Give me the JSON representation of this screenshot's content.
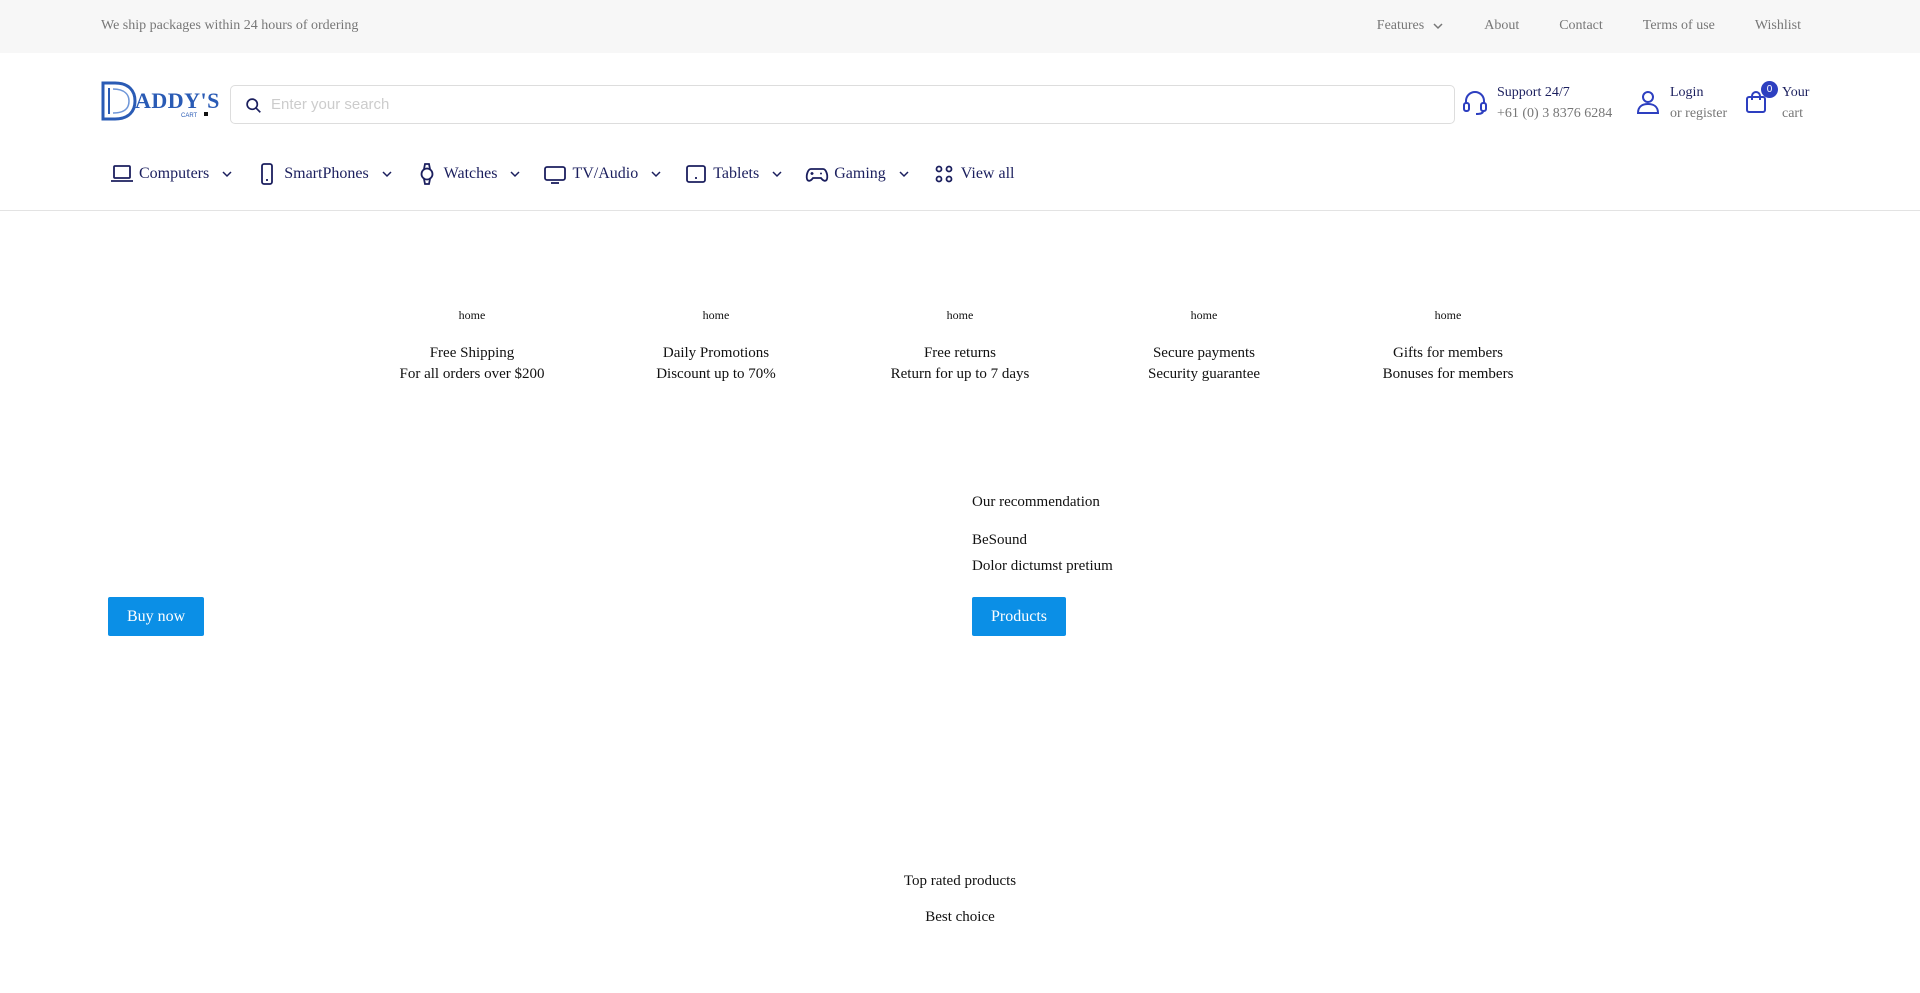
{
  "topbar": {
    "shipping_text": "We ship packages within 24 hours of ordering",
    "links": [
      "Features",
      "About",
      "Contact",
      "Terms of use",
      "Wishlist"
    ]
  },
  "search": {
    "placeholder": "Enter your search",
    "value": ""
  },
  "support": {
    "title": "Support 24/7",
    "phone": "+61 (0) 3 8376 6284"
  },
  "account": {
    "title": "Login",
    "subtitle": "or register"
  },
  "cart": {
    "count": "0",
    "title": "Your",
    "subtitle": "cart"
  },
  "categories": [
    {
      "label": "Computers",
      "icon": "laptop-icon"
    },
    {
      "label": "SmartPhones",
      "icon": "phone-icon"
    },
    {
      "label": "Watches",
      "icon": "watch-icon"
    },
    {
      "label": "TV/Audio",
      "icon": "tv-icon"
    },
    {
      "label": "Tablets",
      "icon": "tablet-icon"
    },
    {
      "label": "Gaming",
      "icon": "gamepad-icon"
    },
    {
      "label": "View all",
      "icon": "grid-icon"
    }
  ],
  "features": [
    {
      "alt": "home",
      "title": "Free Shipping",
      "subtitle": "For all orders over $200"
    },
    {
      "alt": "home",
      "title": "Daily Promotions",
      "subtitle": "Discount up to 70%"
    },
    {
      "alt": "home",
      "title": "Free returns",
      "subtitle": "Return for up to 7 days"
    },
    {
      "alt": "home",
      "title": "Secure payments",
      "subtitle": "Security guarantee"
    },
    {
      "alt": "home",
      "title": "Gifts for members",
      "subtitle": "Bonuses for members"
    }
  ],
  "recommendation": {
    "heading": "Our recommendation",
    "brand": "BeSound",
    "tagline": "Dolor dictumst pretium",
    "button": "Products"
  },
  "hero": {
    "button": "Buy now"
  },
  "top_rated": {
    "heading": "Top rated products",
    "subheading": "Best choice"
  },
  "colors": {
    "brand": "#1b1f5e",
    "button": "#0b8fe6",
    "badge": "#2d3fc0",
    "topbar_bg": "#f7f7f7"
  }
}
